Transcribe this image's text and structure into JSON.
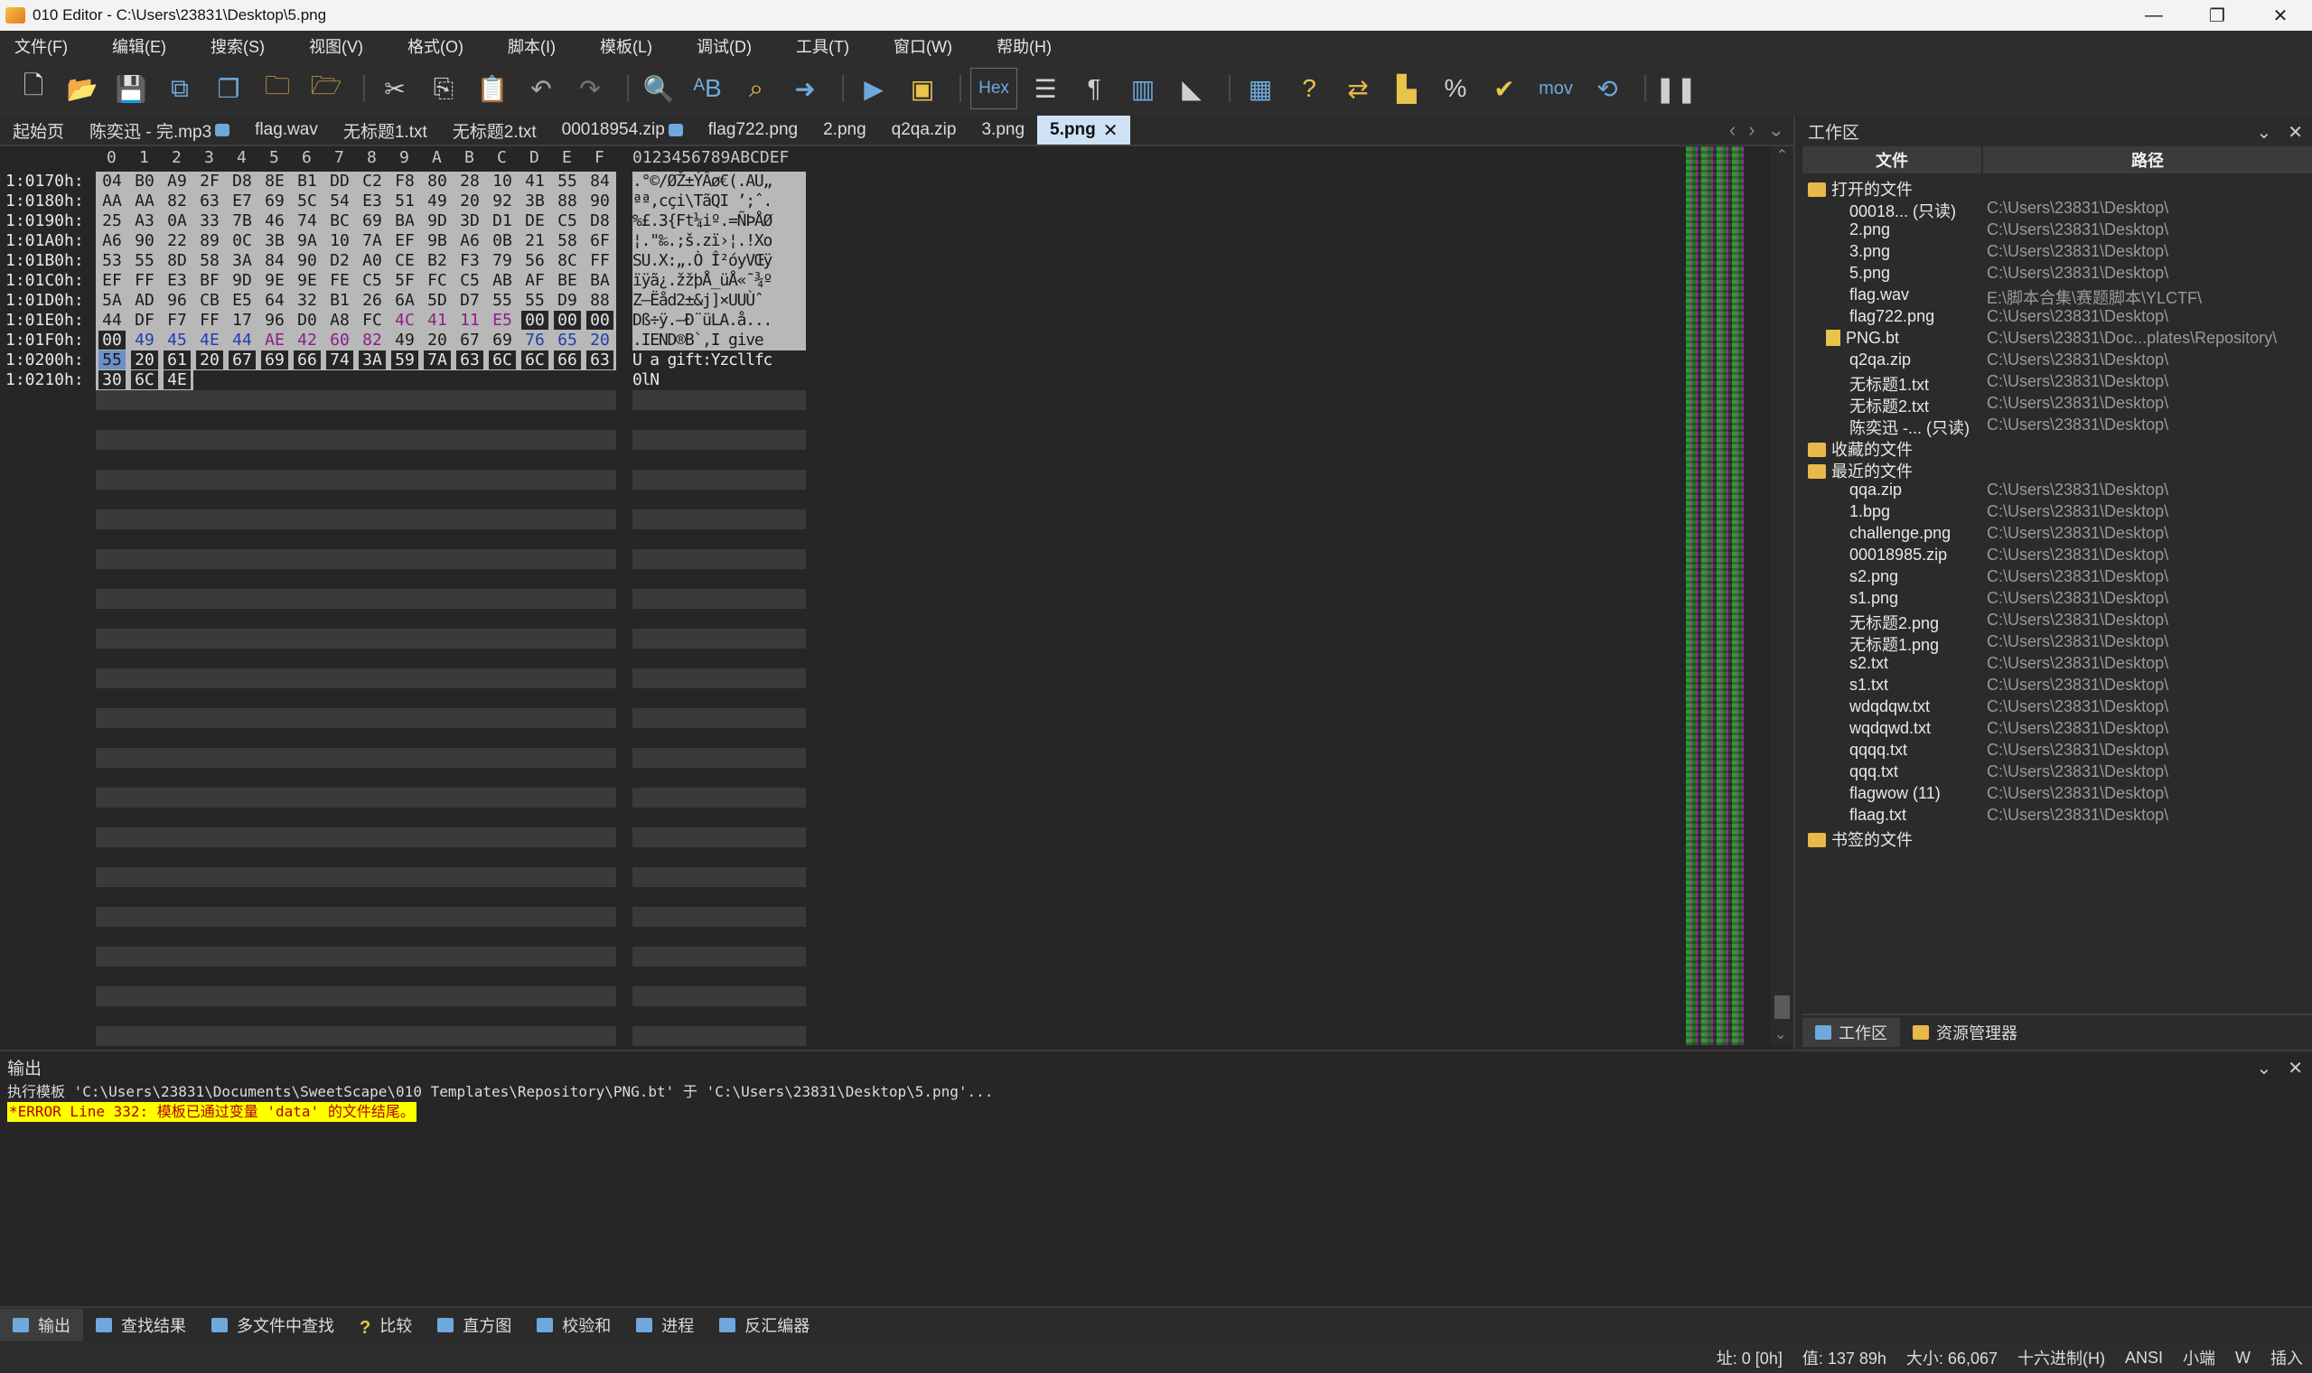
{
  "window": {
    "title": "010 Editor - C:\\Users\\23831\\Desktop\\5.png",
    "minimize": "—",
    "maximize": "❐",
    "close": "✕"
  },
  "menu": [
    "文件(F)",
    "编辑(E)",
    "搜索(S)",
    "视图(V)",
    "格式(O)",
    "脚本(I)",
    "模板(L)",
    "调试(D)",
    "工具(T)",
    "窗口(W)",
    "帮助(H)"
  ],
  "toolbar": {
    "hex_label": "Hex",
    "mov_label": "mov",
    "icons": [
      "new-file-icon",
      "open-file-icon",
      "save-icon",
      "save-all-icon",
      "copy-file-icon",
      "open-folder-icon",
      "folder-multi-icon",
      "cut-icon",
      "copy-icon",
      "paste-icon",
      "undo-icon",
      "redo-icon",
      "find-icon",
      "replace-icon",
      "find-in-files-icon",
      "goto-icon",
      "run-script-icon",
      "run-template-icon",
      "hex-mode-icon",
      "compare-icon",
      "pilcrow-icon",
      "columns-icon",
      "highlight-icon",
      "calculator-icon",
      "inspector-icon",
      "convert-icon",
      "histogram-icon",
      "percent-icon",
      "checksum-icon",
      "mov-icon",
      "base-convert-icon",
      "pause-icon"
    ]
  },
  "tabs": [
    {
      "label": "起始页",
      "lock": false
    },
    {
      "label": "陈奕迅 - 完.mp3",
      "lock": true
    },
    {
      "label": "flag.wav",
      "lock": false
    },
    {
      "label": "无标题1.txt",
      "lock": false
    },
    {
      "label": "无标题2.txt",
      "lock": false
    },
    {
      "label": "00018954.zip",
      "lock": true
    },
    {
      "label": "flag722.png",
      "lock": false
    },
    {
      "label": "2.png",
      "lock": false
    },
    {
      "label": "q2qa.zip",
      "lock": false
    },
    {
      "label": "3.png",
      "lock": false
    },
    {
      "label": "5.png",
      "lock": false,
      "active": true
    }
  ],
  "hex": {
    "col_header": [
      "0",
      "1",
      "2",
      "3",
      "4",
      "5",
      "6",
      "7",
      "8",
      "9",
      "A",
      "B",
      "C",
      "D",
      "E",
      "F"
    ],
    "ascii_header": "0123456789ABCDEF",
    "rows": [
      {
        "addr": "1:0170h:",
        "bytes": [
          "04",
          "B0",
          "A9",
          "2F",
          "D8",
          "8E",
          "B1",
          "DD",
          "C2",
          "F8",
          "80",
          "28",
          "10",
          "41",
          "55",
          "84"
        ],
        "ascii": ".°©/ØŽ±ÝÂø€(.AU„"
      },
      {
        "addr": "1:0180h:",
        "bytes": [
          "AA",
          "AA",
          "82",
          "63",
          "E7",
          "69",
          "5C",
          "54",
          "E3",
          "51",
          "49",
          "20",
          "92",
          "3B",
          "88",
          "90"
        ],
        "ascii": "ªª‚cçi\\TãQI ’;ˆ."
      },
      {
        "addr": "1:0190h:",
        "bytes": [
          "25",
          "A3",
          "0A",
          "33",
          "7B",
          "46",
          "74",
          "BC",
          "69",
          "BA",
          "9D",
          "3D",
          "D1",
          "DE",
          "C5",
          "D8"
        ],
        "ascii": "%£.3{Ft¼iº.=ÑÞÅØ"
      },
      {
        "addr": "1:01A0h:",
        "bytes": [
          "A6",
          "90",
          "22",
          "89",
          "0C",
          "3B",
          "9A",
          "10",
          "7A",
          "EF",
          "9B",
          "A6",
          "0B",
          "21",
          "58",
          "6F"
        ],
        "ascii": "¦.\"‰.;š.zï›¦.!Xo"
      },
      {
        "addr": "1:01B0h:",
        "bytes": [
          "53",
          "55",
          "8D",
          "58",
          "3A",
          "84",
          "90",
          "D2",
          "A0",
          "CE",
          "B2",
          "F3",
          "79",
          "56",
          "8C",
          "FF"
        ],
        "ascii": "SU.X:„.Ò Î²óyVŒÿ"
      },
      {
        "addr": "1:01C0h:",
        "bytes": [
          "EF",
          "FF",
          "E3",
          "BF",
          "9D",
          "9E",
          "9E",
          "FE",
          "C5",
          "5F",
          "FC",
          "C5",
          "AB",
          "AF",
          "BE",
          "BA"
        ],
        "ascii": "ïÿã¿.žžþÅ_üÅ«¯¾º"
      },
      {
        "addr": "1:01D0h:",
        "bytes": [
          "5A",
          "AD",
          "96",
          "CB",
          "E5",
          "64",
          "32",
          "B1",
          "26",
          "6A",
          "5D",
          "D7",
          "55",
          "55",
          "D9",
          "88"
        ],
        "ascii": "Z­–Ëåd2±&j]×UUÙˆ"
      },
      {
        "addr": "1:01E0h:",
        "bytes": [
          "44",
          "DF",
          "F7",
          "FF",
          "17",
          "96",
          "D0",
          "A8",
          "FC",
          "4C",
          "41",
          "11",
          "E5",
          "00",
          "00",
          "00"
        ],
        "ascii": "Dß÷ÿ.–Ð¨üLA.å..."
      },
      {
        "addr": "1:01F0h:",
        "bytes": [
          "00",
          "49",
          "45",
          "4E",
          "44",
          "AE",
          "42",
          "60",
          "82",
          "49",
          "20",
          "67",
          "69",
          "76",
          "65",
          "20"
        ],
        "ascii": ".IEND®B`‚I give "
      },
      {
        "addr": "1:0200h:",
        "bytes": [
          "55",
          "20",
          "61",
          "20",
          "67",
          "69",
          "66",
          "74",
          "3A",
          "59",
          "7A",
          "63",
          "6C",
          "6C",
          "66",
          "63"
        ],
        "ascii": "U a gift:Yzcllfc"
      },
      {
        "addr": "1:0210h:",
        "bytes": [
          "30",
          "6C",
          "4E"
        ],
        "ascii": "0lN"
      }
    ]
  },
  "workspace": {
    "title": "工作区",
    "col_file": "文件",
    "col_path": "路径",
    "open_files_label": "打开的文件",
    "open_files": [
      {
        "name": "00018... (只读)",
        "path": "C:\\Users\\23831\\Desktop\\"
      },
      {
        "name": "2.png",
        "path": "C:\\Users\\23831\\Desktop\\"
      },
      {
        "name": "3.png",
        "path": "C:\\Users\\23831\\Desktop\\"
      },
      {
        "name": "5.png",
        "path": "C:\\Users\\23831\\Desktop\\"
      },
      {
        "name": "flag.wav",
        "path": "E:\\脚本合集\\赛题脚本\\YLCTF\\"
      },
      {
        "name": "flag722.png",
        "path": "C:\\Users\\23831\\Desktop\\"
      },
      {
        "name": "PNG.bt",
        "path": "C:\\Users\\23831\\Doc...plates\\Repository\\",
        "bt": true
      },
      {
        "name": "q2qa.zip",
        "path": "C:\\Users\\23831\\Desktop\\"
      },
      {
        "name": "无标题1.txt",
        "path": "C:\\Users\\23831\\Desktop\\"
      },
      {
        "name": "无标题2.txt",
        "path": "C:\\Users\\23831\\Desktop\\"
      },
      {
        "name": "陈奕迅 -... (只读)",
        "path": "C:\\Users\\23831\\Desktop\\"
      }
    ],
    "favorites_label": "收藏的文件",
    "recent_label": "最近的文件",
    "recent_files": [
      {
        "name": "qqa.zip",
        "path": "C:\\Users\\23831\\Desktop\\"
      },
      {
        "name": "1.bpg",
        "path": "C:\\Users\\23831\\Desktop\\"
      },
      {
        "name": "challenge.png",
        "path": "C:\\Users\\23831\\Desktop\\"
      },
      {
        "name": "00018985.zip",
        "path": "C:\\Users\\23831\\Desktop\\"
      },
      {
        "name": "s2.png",
        "path": "C:\\Users\\23831\\Desktop\\"
      },
      {
        "name": "s1.png",
        "path": "C:\\Users\\23831\\Desktop\\"
      },
      {
        "name": "无标题2.png",
        "path": "C:\\Users\\23831\\Desktop\\"
      },
      {
        "name": "无标题1.png",
        "path": "C:\\Users\\23831\\Desktop\\"
      },
      {
        "name": "s2.txt",
        "path": "C:\\Users\\23831\\Desktop\\"
      },
      {
        "name": "s1.txt",
        "path": "C:\\Users\\23831\\Desktop\\"
      },
      {
        "name": "wdqdqw.txt",
        "path": "C:\\Users\\23831\\Desktop\\"
      },
      {
        "name": "wqdqwd.txt",
        "path": "C:\\Users\\23831\\Desktop\\"
      },
      {
        "name": "qqqq.txt",
        "path": "C:\\Users\\23831\\Desktop\\"
      },
      {
        "name": "qqq.txt",
        "path": "C:\\Users\\23831\\Desktop\\"
      },
      {
        "name": "flagwow (11)",
        "path": "C:\\Users\\23831\\Desktop\\"
      },
      {
        "name": "flaag.txt",
        "path": "C:\\Users\\23831\\Desktop\\"
      }
    ],
    "bookmarks_label": "书签的文件",
    "tab_workspace": "工作区",
    "tab_explorer": "资源管理器"
  },
  "output": {
    "title": "输出",
    "line1": "执行模板 'C:\\Users\\23831\\Documents\\SweetScape\\010 Templates\\Repository\\PNG.bt' 于 'C:\\Users\\23831\\Desktop\\5.png'...",
    "error": "*ERROR Line 332: 模板已通过变量 'data' 的文件结尾。"
  },
  "bottom_tabs": [
    "输出",
    "查找结果",
    "多文件中查找",
    "比较",
    "直方图",
    "校验和",
    "进程",
    "反汇编器"
  ],
  "status": {
    "address": "址: 0 [0h]",
    "value": "值: 137 89h",
    "size": "大小: 66,067",
    "mode": "十六进制(H)",
    "encoding": "ANSI",
    "endian": "小端",
    "w": "W",
    "insert": "插入"
  },
  "colors": {
    "accent": "#6fa8dc",
    "active_tab": "#cfe2f5",
    "error_bg": "#ffff00",
    "error_fg": "#b00000",
    "hex_bg": "#b8b8b8",
    "byte_purple": "#8b1f8b",
    "byte_blue": "#1f3fae",
    "selection": "#6e8fc8"
  }
}
